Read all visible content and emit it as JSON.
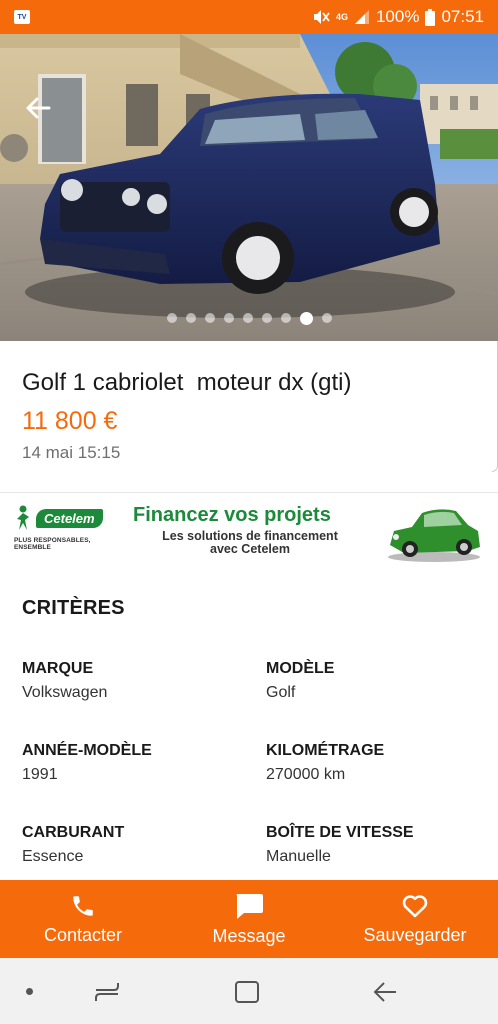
{
  "status_bar": {
    "battery": "100%",
    "time": "07:51",
    "network": "4G"
  },
  "gallery": {
    "image_count": 9,
    "active_index": 7
  },
  "listing": {
    "title": "Golf 1 cabriolet  moteur dx (gti)",
    "price": "11 800 €",
    "date": "14 mai 15:15"
  },
  "ad": {
    "brand": "Cetelem",
    "tagline": "PLUS RESPONSABLES, ENSEMBLE",
    "headline": "Financez vos projets",
    "subline": "Les solutions de financement avec Cetelem",
    "colors": {
      "green": "#1c8a3a"
    }
  },
  "criteria": {
    "title": "CRITÈRES",
    "items": [
      {
        "label": "MARQUE",
        "value": "Volkswagen"
      },
      {
        "label": "MODÈLE",
        "value": "Golf"
      },
      {
        "label": "ANNÉE-MODÈLE",
        "value": "1991"
      },
      {
        "label": "KILOMÉTRAGE",
        "value": "270000 km"
      },
      {
        "label": "CARBURANT",
        "value": "Essence"
      },
      {
        "label": "BOÎTE DE VITESSE",
        "value": "Manuelle"
      }
    ]
  },
  "actions": {
    "contact": "Contacter",
    "message": "Message",
    "save": "Sauvegarder"
  },
  "colors": {
    "accent": "#f56b0c",
    "price": "#f56b0c"
  },
  "icons": [
    "back-arrow-icon",
    "phone-icon",
    "chat-bubble-icon",
    "heart-icon",
    "recent-apps-icon",
    "home-icon",
    "nav-back-icon"
  ]
}
